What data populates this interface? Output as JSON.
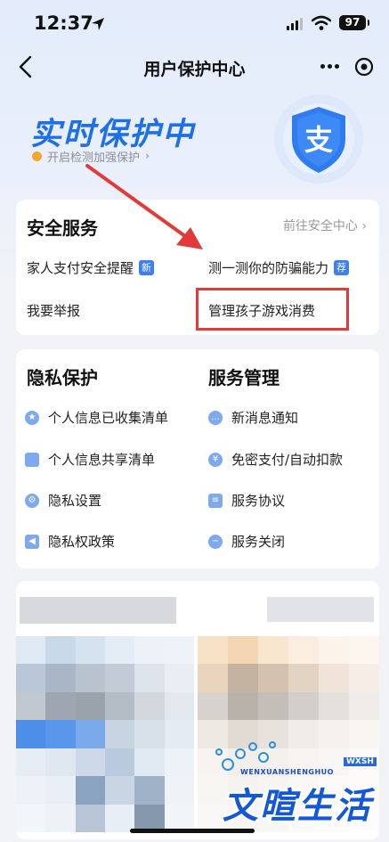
{
  "status": {
    "time": "12:37",
    "battery": "97"
  },
  "nav": {
    "title": "用户保护中心"
  },
  "hero": {
    "title": "实时保护中",
    "subtitle": "开启检测加强保护",
    "shield_char": "支"
  },
  "security": {
    "title": "安全服务",
    "goto": "前往安全中心",
    "items": [
      {
        "label": "家人支付安全提醒",
        "tag": "新"
      },
      {
        "label": "测一测你的防骗能力",
        "tag": "荐"
      },
      {
        "label": "我要举报"
      },
      {
        "label": "管理孩子游戏消费"
      }
    ]
  },
  "privacy": {
    "title": "隐私保护",
    "items": [
      "个人信息已收集清单",
      "个人信息共享清单",
      "隐私设置",
      "隐私权政策"
    ]
  },
  "service": {
    "title": "服务管理",
    "items": [
      "新消息通知",
      "免密支付/自动扣款",
      "服务协议",
      "服务关闭"
    ]
  },
  "watermark": {
    "main": "文暄生活",
    "sub": "WENXUANSHENGHUO",
    "tag": "WXSH"
  },
  "colors": {
    "accent": "#1e6fe8",
    "highlight": "#e23a3a",
    "tag_blue": "#3d7ef5"
  }
}
